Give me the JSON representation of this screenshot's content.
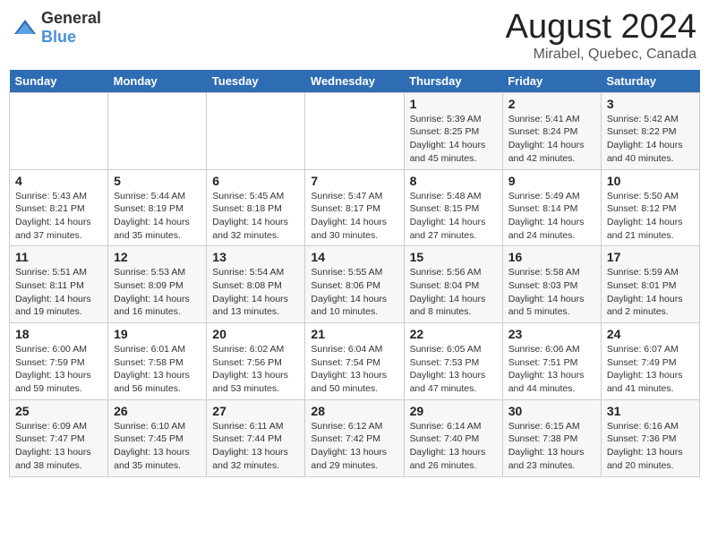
{
  "header": {
    "logo_general": "General",
    "logo_blue": "Blue",
    "title": "August 2024",
    "subtitle": "Mirabel, Quebec, Canada"
  },
  "weekdays": [
    "Sunday",
    "Monday",
    "Tuesday",
    "Wednesday",
    "Thursday",
    "Friday",
    "Saturday"
  ],
  "weeks": [
    [
      {
        "day": "",
        "info": ""
      },
      {
        "day": "",
        "info": ""
      },
      {
        "day": "",
        "info": ""
      },
      {
        "day": "",
        "info": ""
      },
      {
        "day": "1",
        "info": "Sunrise: 5:39 AM\nSunset: 8:25 PM\nDaylight: 14 hours\nand 45 minutes."
      },
      {
        "day": "2",
        "info": "Sunrise: 5:41 AM\nSunset: 8:24 PM\nDaylight: 14 hours\nand 42 minutes."
      },
      {
        "day": "3",
        "info": "Sunrise: 5:42 AM\nSunset: 8:22 PM\nDaylight: 14 hours\nand 40 minutes."
      }
    ],
    [
      {
        "day": "4",
        "info": "Sunrise: 5:43 AM\nSunset: 8:21 PM\nDaylight: 14 hours\nand 37 minutes."
      },
      {
        "day": "5",
        "info": "Sunrise: 5:44 AM\nSunset: 8:19 PM\nDaylight: 14 hours\nand 35 minutes."
      },
      {
        "day": "6",
        "info": "Sunrise: 5:45 AM\nSunset: 8:18 PM\nDaylight: 14 hours\nand 32 minutes."
      },
      {
        "day": "7",
        "info": "Sunrise: 5:47 AM\nSunset: 8:17 PM\nDaylight: 14 hours\nand 30 minutes."
      },
      {
        "day": "8",
        "info": "Sunrise: 5:48 AM\nSunset: 8:15 PM\nDaylight: 14 hours\nand 27 minutes."
      },
      {
        "day": "9",
        "info": "Sunrise: 5:49 AM\nSunset: 8:14 PM\nDaylight: 14 hours\nand 24 minutes."
      },
      {
        "day": "10",
        "info": "Sunrise: 5:50 AM\nSunset: 8:12 PM\nDaylight: 14 hours\nand 21 minutes."
      }
    ],
    [
      {
        "day": "11",
        "info": "Sunrise: 5:51 AM\nSunset: 8:11 PM\nDaylight: 14 hours\nand 19 minutes."
      },
      {
        "day": "12",
        "info": "Sunrise: 5:53 AM\nSunset: 8:09 PM\nDaylight: 14 hours\nand 16 minutes."
      },
      {
        "day": "13",
        "info": "Sunrise: 5:54 AM\nSunset: 8:08 PM\nDaylight: 14 hours\nand 13 minutes."
      },
      {
        "day": "14",
        "info": "Sunrise: 5:55 AM\nSunset: 8:06 PM\nDaylight: 14 hours\nand 10 minutes."
      },
      {
        "day": "15",
        "info": "Sunrise: 5:56 AM\nSunset: 8:04 PM\nDaylight: 14 hours\nand 8 minutes."
      },
      {
        "day": "16",
        "info": "Sunrise: 5:58 AM\nSunset: 8:03 PM\nDaylight: 14 hours\nand 5 minutes."
      },
      {
        "day": "17",
        "info": "Sunrise: 5:59 AM\nSunset: 8:01 PM\nDaylight: 14 hours\nand 2 minutes."
      }
    ],
    [
      {
        "day": "18",
        "info": "Sunrise: 6:00 AM\nSunset: 7:59 PM\nDaylight: 13 hours\nand 59 minutes."
      },
      {
        "day": "19",
        "info": "Sunrise: 6:01 AM\nSunset: 7:58 PM\nDaylight: 13 hours\nand 56 minutes."
      },
      {
        "day": "20",
        "info": "Sunrise: 6:02 AM\nSunset: 7:56 PM\nDaylight: 13 hours\nand 53 minutes."
      },
      {
        "day": "21",
        "info": "Sunrise: 6:04 AM\nSunset: 7:54 PM\nDaylight: 13 hours\nand 50 minutes."
      },
      {
        "day": "22",
        "info": "Sunrise: 6:05 AM\nSunset: 7:53 PM\nDaylight: 13 hours\nand 47 minutes."
      },
      {
        "day": "23",
        "info": "Sunrise: 6:06 AM\nSunset: 7:51 PM\nDaylight: 13 hours\nand 44 minutes."
      },
      {
        "day": "24",
        "info": "Sunrise: 6:07 AM\nSunset: 7:49 PM\nDaylight: 13 hours\nand 41 minutes."
      }
    ],
    [
      {
        "day": "25",
        "info": "Sunrise: 6:09 AM\nSunset: 7:47 PM\nDaylight: 13 hours\nand 38 minutes."
      },
      {
        "day": "26",
        "info": "Sunrise: 6:10 AM\nSunset: 7:45 PM\nDaylight: 13 hours\nand 35 minutes."
      },
      {
        "day": "27",
        "info": "Sunrise: 6:11 AM\nSunset: 7:44 PM\nDaylight: 13 hours\nand 32 minutes."
      },
      {
        "day": "28",
        "info": "Sunrise: 6:12 AM\nSunset: 7:42 PM\nDaylight: 13 hours\nand 29 minutes."
      },
      {
        "day": "29",
        "info": "Sunrise: 6:14 AM\nSunset: 7:40 PM\nDaylight: 13 hours\nand 26 minutes."
      },
      {
        "day": "30",
        "info": "Sunrise: 6:15 AM\nSunset: 7:38 PM\nDaylight: 13 hours\nand 23 minutes."
      },
      {
        "day": "31",
        "info": "Sunrise: 6:16 AM\nSunset: 7:36 PM\nDaylight: 13 hours\nand 20 minutes."
      }
    ]
  ]
}
